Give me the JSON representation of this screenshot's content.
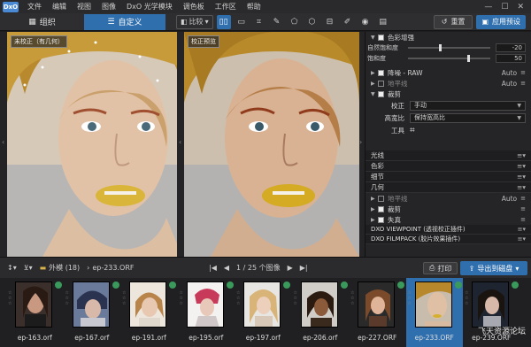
{
  "menubar": {
    "logo": "DxO",
    "items": [
      "文件",
      "编辑",
      "视图",
      "图像",
      "DxO 光学模块",
      "调色板",
      "工作区",
      "帮助"
    ]
  },
  "toolbar": {
    "tab_organize": "组织",
    "tab_custom": "自定义",
    "compare": "比较",
    "reset": "重置",
    "apply_preset": "应用预设"
  },
  "viewer": {
    "left_label": "未校正（有几何）",
    "right_label": "校正预览"
  },
  "panel": {
    "color_enhance": "色彩增强",
    "vibrance_label": "自然饱和度",
    "vibrance_value": "-20",
    "saturation_label": "饱和度",
    "saturation_value": "50",
    "noise": "降噪 - RAW",
    "noise_auto": "Auto",
    "horizon": "地平线",
    "horizon_auto": "Auto",
    "crop": "裁剪",
    "correction_label": "校正",
    "correction_value": "手动",
    "aspect_label": "高宽比",
    "aspect_value": "保持宽高比",
    "tool_label": "工具",
    "sections": [
      "光线",
      "色彩",
      "细节",
      "几何"
    ],
    "geo_horizon": "地平线",
    "geo_horizon_auto": "Auto",
    "geo_crop": "裁剪",
    "geo_distort": "失真",
    "plugin1": "DXO VIEWPOINT (透视校正插件)",
    "plugin2": "DXO FILMPACK (胶片效果插件)"
  },
  "filmbar": {
    "folder": "外模 (18)",
    "current_file": "ep-233.ORF",
    "pager": "1 / 25 个图像",
    "print": "打印",
    "export": "导出到磁盘"
  },
  "thumbnails": [
    {
      "name": "ep-163.orf"
    },
    {
      "name": "ep-167.orf"
    },
    {
      "name": "ep-191.orf"
    },
    {
      "name": "ep-195.orf"
    },
    {
      "name": "ep-197.orf"
    },
    {
      "name": "ep-206.orf"
    },
    {
      "name": "ep-227.ORF"
    },
    {
      "name": "ep-233.ORF"
    },
    {
      "name": "ep-239.ORF"
    }
  ],
  "watermark": "飞天资源论坛",
  "colors": {
    "accent": "#2f6fae",
    "badge": "#3a9a5b"
  }
}
